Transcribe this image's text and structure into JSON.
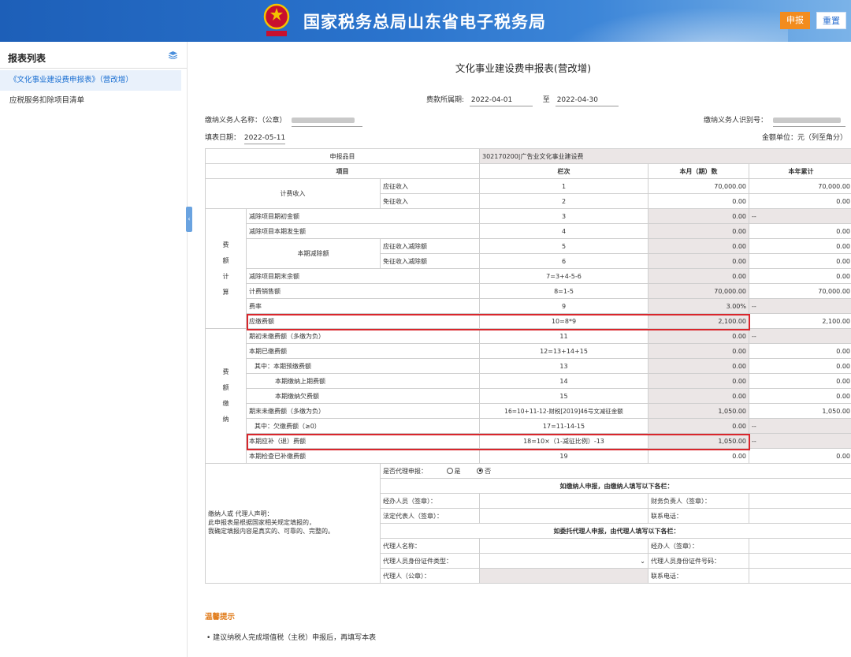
{
  "header": {
    "title": "国家税务总局山东省电子税务局",
    "submit_label": "申报",
    "reset_label": "重置",
    "brand_color": "#2a73cc"
  },
  "sidebar": {
    "title": "报表列表",
    "items": [
      {
        "label": "《文化事业建设费申报表》（营改增）",
        "active": true
      },
      {
        "label": "应税服务扣除项目清单",
        "active": false
      }
    ]
  },
  "form": {
    "title": "文化事业建设费申报表(营改增)",
    "period_label": "费款所属期:",
    "period_start": "2022-04-01",
    "period_to": "至",
    "period_end": "2022-04-30",
    "payer_name_label": "缴纳义务人名称：（公章）",
    "payer_id_label": "缴纳义务人识别号：",
    "fill_date_label": "填表日期：",
    "fill_date": "2022-05-11",
    "unit_label": "金额单位：元（列至角分）"
  },
  "table": {
    "item_label": "申报品目",
    "item_value": "302170200|广告业文化事业建设费",
    "col_project": "项目",
    "col_line": "栏次",
    "col_month": "本月（期）数",
    "col_year": "本年累计",
    "group_fee_income": "计费收入",
    "group_fee_calc": [
      "费",
      "额",
      "计",
      "算"
    ],
    "group_fee_pay": [
      "费",
      "额",
      "缴",
      "纳"
    ],
    "sub_current_deduct": "本期减除额",
    "rows": [
      {
        "name": "应征收入",
        "line": "1",
        "month": "70,000.00",
        "year": "70,000.00"
      },
      {
        "name": "免征收入",
        "line": "2",
        "month": "0.00",
        "year": "0.00"
      },
      {
        "name": "减除项目期初金额",
        "line": "3",
        "month": "0.00",
        "year": "--"
      },
      {
        "name": "减除项目本期发生额",
        "line": "4",
        "month": "0.00",
        "year": "0.00"
      },
      {
        "name": "应征收入减除额",
        "line": "5",
        "month": "0.00",
        "year": "0.00"
      },
      {
        "name": "免征收入减除额",
        "line": "6",
        "month": "0.00",
        "year": "0.00"
      },
      {
        "name": "减除项目期末余额",
        "line": "7=3+4-5-6",
        "month": "0.00",
        "year": "0.00"
      },
      {
        "name": "计费销售额",
        "line": "8=1-5",
        "month": "70,000.00",
        "year": "70,000.00"
      },
      {
        "name": "费率",
        "line": "9",
        "month": "3.00%",
        "year": "--"
      },
      {
        "name": "应缴费额",
        "line": "10=8*9",
        "month": "2,100.00",
        "year": "2,100.00"
      },
      {
        "name": "期初未缴费额（多缴为负）",
        "line": "11",
        "month": "0.00",
        "year": "--"
      },
      {
        "name": "本期已缴费额",
        "line": "12=13+14+15",
        "month": "0.00",
        "year": "0.00"
      },
      {
        "name": "其中：本期预缴费额",
        "line": "13",
        "month": "0.00",
        "year": "0.00"
      },
      {
        "name": "本期缴纳上期费额",
        "line": "14",
        "month": "0.00",
        "year": "0.00"
      },
      {
        "name": "本期缴纳欠费额",
        "line": "15",
        "month": "0.00",
        "year": "0.00"
      },
      {
        "name": "期末未缴费额（多缴为负）",
        "line": "16=10+11-12-财税[2019]46号文减征金额",
        "month": "1,050.00",
        "year": "1,050.00"
      },
      {
        "name": "其中：欠缴费额（≥0）",
        "line": "17=11-14-15",
        "month": "0.00",
        "year": "--"
      },
      {
        "name": "本期应补（退）费额",
        "line": "18=10×（1-减征比例）-13",
        "month": "1,050.00",
        "year": "--"
      },
      {
        "name": "本期检查已补缴费额",
        "line": "19",
        "month": "0.00",
        "year": "0.00"
      }
    ],
    "declaration": {
      "agent_q": "是否代理申报：",
      "yes": "是",
      "no": "否",
      "self_header": "如缴纳人申报，由缴纳人填写以下各栏：",
      "agent_header": "如委托代理人申报，由代理人填写以下各栏：",
      "statement_1": "缴纳人或 代理人声明：",
      "statement_2": "此申报表是根据国家相关规定填报的，",
      "statement_3": "我确定填报内容是真实的、可靠的、完整的。",
      "handler": "经办人员（签章）：",
      "finance": "财务负责人（签章）：",
      "legal": "法定代表人（签章）：",
      "phone": "联系电话：",
      "agent_name": "代理人名称：",
      "agent_handler": "经办人（签章）：",
      "agent_id_type": "代理人员身份证件类型：",
      "agent_id_no": "代理人员身份证件号码：",
      "agent_seal": "代理人（公章）：",
      "agent_phone": "联系电话："
    }
  },
  "tips": {
    "title": "温馨提示",
    "text": "• 建议纳税人完成增值税（主税）申报后，再填写本表"
  },
  "highlight_color": "#d9262c"
}
